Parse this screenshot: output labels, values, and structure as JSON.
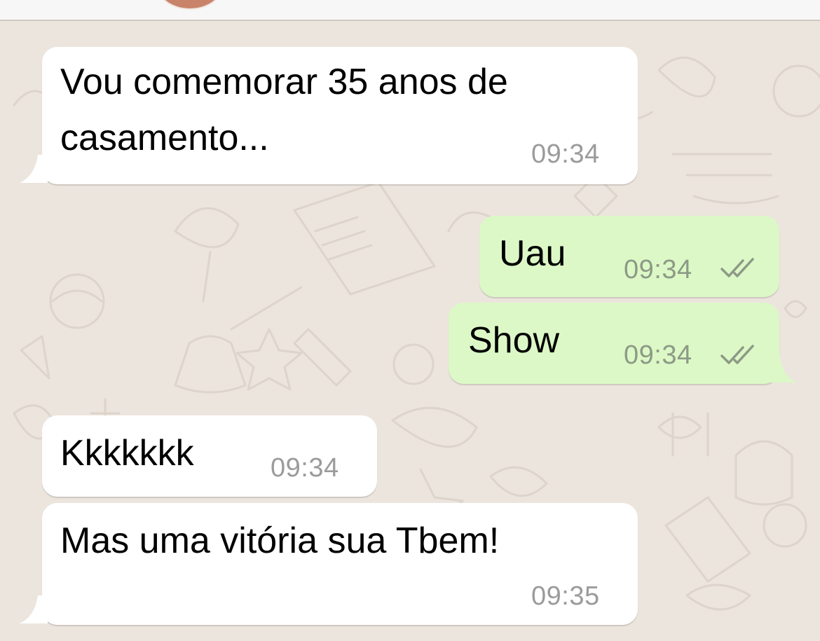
{
  "chat": {
    "messages": [
      {
        "direction": "incoming",
        "text": "Vou comemorar 35 anos de\ncasamento...",
        "time": "09:34"
      },
      {
        "direction": "outgoing",
        "text": "Uau",
        "time": "09:34",
        "status": "double-check-icon"
      },
      {
        "direction": "outgoing",
        "text": "Show",
        "time": "09:34",
        "status": "double-check-icon"
      },
      {
        "direction": "incoming",
        "text": "Kkkkkkk",
        "time": "09:34"
      },
      {
        "direction": "incoming",
        "text": "Mas uma vitória sua Tbem!",
        "time": "09:35"
      }
    ]
  },
  "colors": {
    "background": "#ece5dd",
    "incoming_bubble": "#ffffff",
    "outgoing_bubble": "#dcf8c6",
    "timestamp": "#9b9b9b",
    "tick": "#8d9a86"
  }
}
